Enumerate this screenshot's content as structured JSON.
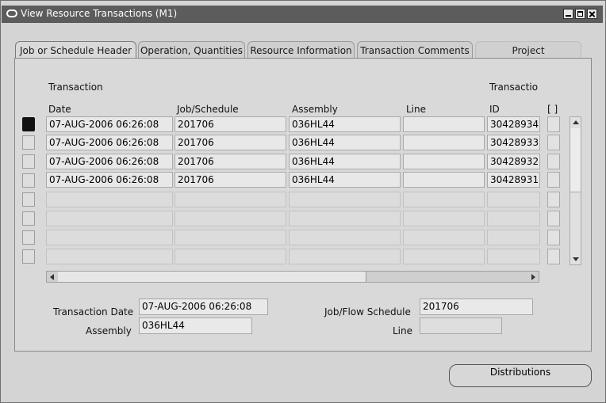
{
  "window": {
    "title": "View Resource Transactions (M1)"
  },
  "tabs": [
    "Job or Schedule Header",
    "Operation, Quantities",
    "Resource Information",
    "Transaction Comments",
    "Project"
  ],
  "table": {
    "headers": {
      "date_top": "Transaction",
      "date": "Date",
      "job": "Job/Schedule",
      "assembly": "Assembly",
      "line": "Line",
      "id_top": "Transactio",
      "id": "ID",
      "flex": "[ ]"
    },
    "rows": [
      {
        "date": "07-AUG-2006 06:26:08",
        "job": "201706",
        "assembly": "036HL44",
        "line": "",
        "id": "30428934"
      },
      {
        "date": "07-AUG-2006 06:26:08",
        "job": "201706",
        "assembly": "036HL44",
        "line": "",
        "id": "30428933"
      },
      {
        "date": "07-AUG-2006 06:26:08",
        "job": "201706",
        "assembly": "036HL44",
        "line": "",
        "id": "30428932"
      },
      {
        "date": "07-AUG-2006 06:26:08",
        "job": "201706",
        "assembly": "036HL44",
        "line": "",
        "id": "30428931"
      }
    ]
  },
  "details": {
    "transaction_date_label": "Transaction Date",
    "transaction_date": "07-AUG-2006 06:26:08",
    "assembly_label": "Assembly",
    "assembly": "036HL44",
    "job_label": "Job/Flow Schedule",
    "job": "201706",
    "line_label": "Line",
    "line": ""
  },
  "buttons": {
    "distributions": "Distributions"
  }
}
